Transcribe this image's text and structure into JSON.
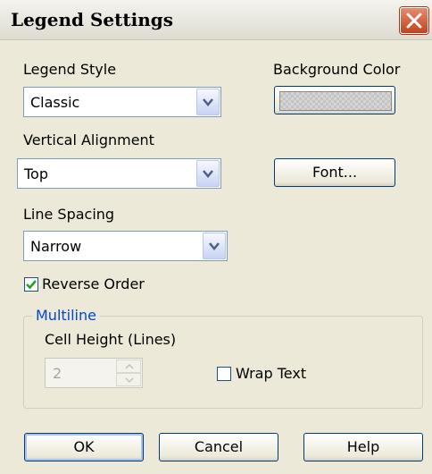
{
  "dialog": {
    "title": "Legend Settings"
  },
  "legend_style": {
    "label": "Legend Style",
    "value": "Classic"
  },
  "background_color": {
    "label": "Background Color"
  },
  "vertical_alignment": {
    "label": "Vertical Alignment",
    "value": "Top"
  },
  "font_button": {
    "label": "Font..."
  },
  "line_spacing": {
    "label": "Line Spacing",
    "value": "Narrow"
  },
  "reverse_order": {
    "label": "Reverse Order",
    "checked": true
  },
  "multiline": {
    "title": "Multiline",
    "cell_height": {
      "label": "Cell Height (Lines)",
      "value": "2",
      "enabled": false
    },
    "wrap_text": {
      "label": "Wrap Text",
      "checked": false
    }
  },
  "buttons": {
    "ok": "OK",
    "cancel": "Cancel",
    "help": "Help"
  },
  "colors": {
    "accent": "#0046d5",
    "close": "#c2431d",
    "face": "#ece9d8"
  }
}
